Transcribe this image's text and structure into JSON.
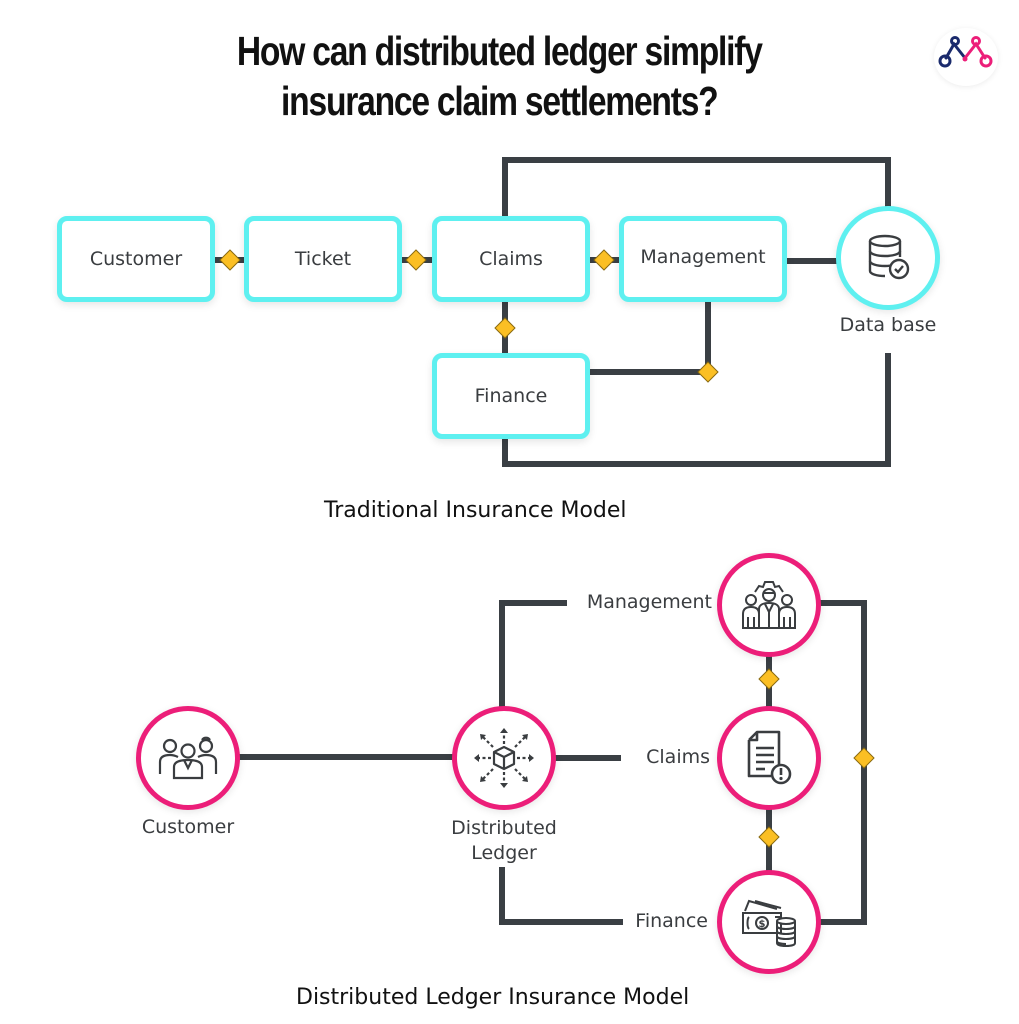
{
  "title": {
    "line1": "How can distributed ledger simplify",
    "line2": "insurance claim settlements?"
  },
  "logo": {
    "icon": "brand-logo-icon",
    "colors": {
      "left": "#1a2a6c",
      "right": "#ec1e79"
    }
  },
  "traditional": {
    "caption": "Traditional Insurance Model",
    "nodes": {
      "customer": "Customer",
      "ticket": "Ticket",
      "claims": "Claims",
      "management": "Management",
      "finance": "Finance",
      "database": "Data base"
    },
    "database_icon": "database-check-icon",
    "border_color": "#5ef0f0"
  },
  "distributed": {
    "caption": "Distributed Ledger Insurance Model",
    "nodes": {
      "customer": "Customer",
      "ledger_line1": "Distributed",
      "ledger_line2": "Ledger",
      "management": "Management",
      "claims": "Claims",
      "finance": "Finance"
    },
    "icons": {
      "customer": "customers-group-icon",
      "ledger": "distributed-box-arrows-icon",
      "management": "management-team-gear-icon",
      "claims": "claim-document-alert-icon",
      "finance": "cash-coins-icon"
    },
    "border_color": "#ec1e79"
  },
  "colors": {
    "connector": "#3a3f44",
    "diamond": "#fbbf24",
    "diamond_stroke": "#8a6a10"
  }
}
